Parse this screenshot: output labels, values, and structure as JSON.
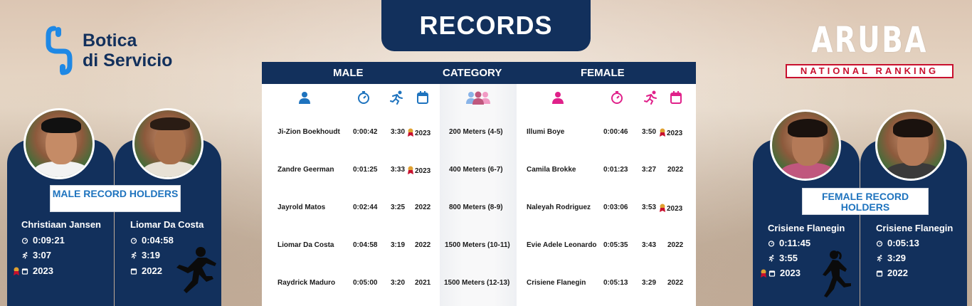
{
  "header": {
    "title": "RECORDS"
  },
  "logo": {
    "line1": "Botica",
    "line2": "di Servicio"
  },
  "aruba": {
    "title": "ARUBA",
    "subtitle": "NATIONAL RANKING"
  },
  "table": {
    "headers": {
      "male": "MALE",
      "category": "CATEGORY",
      "female": "FEMALE"
    },
    "rows": [
      {
        "male_name": "Ji-Zion Boekhoudt",
        "male_time": "0:00:42",
        "male_score": "3:30",
        "male_medal": true,
        "male_year": "2023",
        "category": "200 Meters (4-5)",
        "female_name": "Illumi Boye",
        "female_time": "0:00:46",
        "female_score": "3:50",
        "female_medal": true,
        "female_year": "2023"
      },
      {
        "male_name": "Zandre Geerman",
        "male_time": "0:01:25",
        "male_score": "3:33",
        "male_medal": true,
        "male_year": "2023",
        "category": "400 Meters (6-7)",
        "female_name": "Camila Brokke",
        "female_time": "0:01:23",
        "female_score": "3:27",
        "female_medal": false,
        "female_year": "2022"
      },
      {
        "male_name": "Jayrold Matos",
        "male_time": "0:02:44",
        "male_score": "3:25",
        "male_medal": false,
        "male_year": "2022",
        "category": "800 Meters (8-9)",
        "female_name": "Naleyah Rodriguez",
        "female_time": "0:03:06",
        "female_score": "3:53",
        "female_medal": true,
        "female_year": "2023"
      },
      {
        "male_name": "Liomar Da Costa",
        "male_time": "0:04:58",
        "male_score": "3:19",
        "male_medal": false,
        "male_year": "2022",
        "category": "1500 Meters (10-11)",
        "female_name": "Evie Adele Leonardo",
        "female_time": "0:05:35",
        "female_score": "3:43",
        "female_medal": false,
        "female_year": "2022"
      },
      {
        "male_name": "Raydrick Maduro",
        "male_time": "0:05:00",
        "male_score": "3:20",
        "male_medal": false,
        "male_year": "2021",
        "category": "1500 Meters (12-13)",
        "female_name": "Crisiene Flanegin",
        "female_time": "0:05:13",
        "female_score": "3:29",
        "female_medal": false,
        "female_year": "2022"
      }
    ]
  },
  "male_holders": {
    "label": "MALE RECORD HOLDERS",
    "people": [
      {
        "name": "Christiaan Jansen",
        "time": "0:09:21",
        "score": "3:07",
        "year": "2023",
        "medal": true
      },
      {
        "name": "Liomar Da Costa",
        "time": "0:04:58",
        "score": "3:19",
        "year": "2022",
        "medal": false
      }
    ]
  },
  "female_holders": {
    "label": "FEMALE RECORD HOLDERS",
    "people": [
      {
        "name": "Crisiene Flanegin",
        "time": "0:11:45",
        "score": "3:55",
        "year": "2023",
        "medal": true
      },
      {
        "name": "Crisiene Flanegin",
        "time": "0:05:13",
        "score": "3:29",
        "year": "2022",
        "medal": false
      }
    ]
  },
  "colors": {
    "navy": "#12305c",
    "male_accent": "#1e73be",
    "female_accent": "#e0218a",
    "medal": "#c8102e",
    "label_blue": "#1e73be"
  },
  "icons": {
    "person": "person-icon",
    "stopwatch": "stopwatch-icon",
    "runner": "runner-icon",
    "calendar": "calendar-icon",
    "group": "group-icon",
    "medal": "medal-icon"
  }
}
